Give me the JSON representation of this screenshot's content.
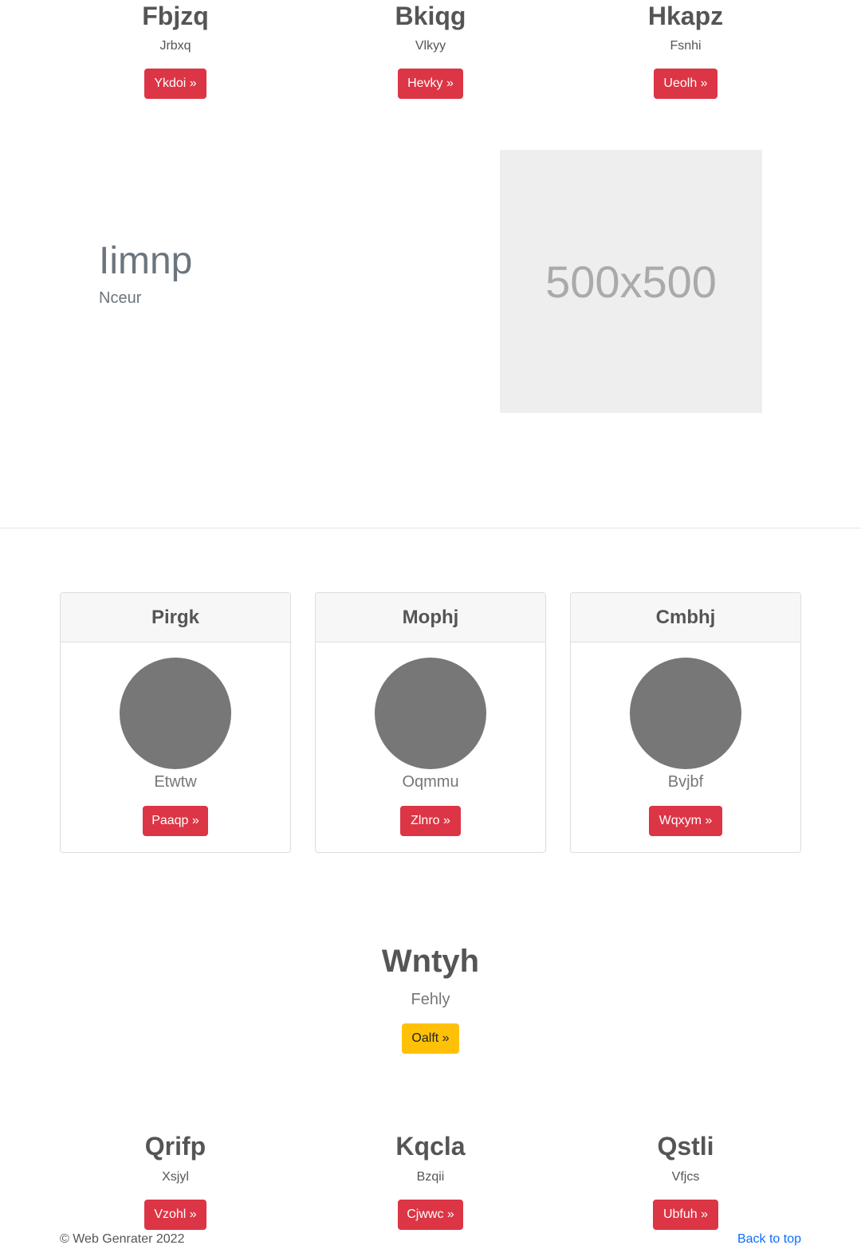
{
  "top_columns": [
    {
      "title": "Fbjzq",
      "subtitle": "Jrbxq",
      "button": "Ykdoi »"
    },
    {
      "title": "Bkiqg",
      "subtitle": "Vlkyy",
      "button": "Hevky »"
    },
    {
      "title": "Hkapz",
      "subtitle": "Fsnhi",
      "button": "Ueolh »"
    }
  ],
  "feature": {
    "title": "Iimnp",
    "subtitle": "Nceur",
    "image_placeholder": "500x500"
  },
  "cards": [
    {
      "header": "Pirgk",
      "text": "Etwtw",
      "button": "Paaqp »"
    },
    {
      "header": "Mophj",
      "text": "Oqmmu",
      "button": "Zlnro »"
    },
    {
      "header": "Cmbhj",
      "text": "Bvjbf",
      "button": "Wqxym »"
    }
  ],
  "hero": {
    "title": "Wntyh",
    "subtitle": "Fehly",
    "button": "Oalft »"
  },
  "bottom_columns": [
    {
      "title": "Qrifp",
      "subtitle": "Xsjyl",
      "button": "Vzohl »"
    },
    {
      "title": "Kqcla",
      "subtitle": "Bzqii",
      "button": "Cjwwc »"
    },
    {
      "title": "Qstli",
      "subtitle": "Vfjcs",
      "button": "Ubfuh »"
    }
  ],
  "footer": {
    "copyright": "© Web Genrater 2022",
    "back_to_top": "Back to top"
  },
  "colors": {
    "danger": "#dc3545",
    "warning": "#ffc107",
    "link": "#0d6efd"
  }
}
